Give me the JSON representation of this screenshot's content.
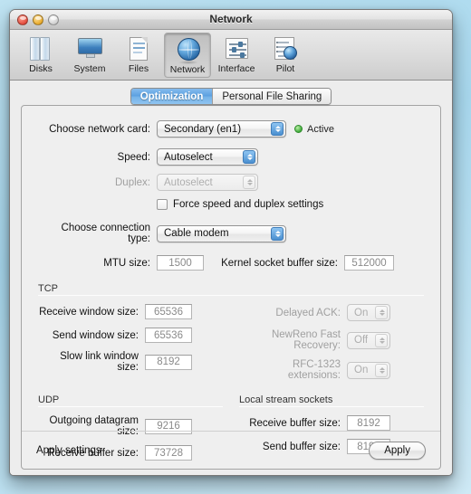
{
  "window": {
    "title": "Network",
    "controls": {
      "close": "close",
      "minimize": "minimize",
      "zoom": "zoom"
    }
  },
  "toolbar": {
    "items": [
      {
        "label": "Disks",
        "icon": "disks-icon",
        "selected": false
      },
      {
        "label": "System",
        "icon": "monitor-icon",
        "selected": false
      },
      {
        "label": "Files",
        "icon": "document-icon",
        "selected": false
      },
      {
        "label": "Network",
        "icon": "globe-icon",
        "selected": true
      },
      {
        "label": "Interface",
        "icon": "sliders-icon",
        "selected": false
      },
      {
        "label": "Pilot",
        "icon": "pilot-icon",
        "selected": false
      }
    ]
  },
  "tabs": [
    {
      "label": "Optimization",
      "active": true
    },
    {
      "label": "Personal File Sharing",
      "active": false
    }
  ],
  "form": {
    "network_card": {
      "label": "Choose network card:",
      "value": "Secondary (en1)",
      "status": "Active",
      "status_color": "#3faa3a"
    },
    "speed": {
      "label": "Speed:",
      "value": "Autoselect",
      "disabled": false
    },
    "duplex": {
      "label": "Duplex:",
      "value": "Autoselect",
      "disabled": true
    },
    "force": {
      "label": "Force speed and duplex settings",
      "checked": false
    },
    "connection_type": {
      "label": "Choose connection type:",
      "value": "Cable modem"
    },
    "mtu": {
      "label": "MTU size:",
      "value": "1500"
    },
    "kernel_buffer": {
      "label": "Kernel socket buffer size:",
      "value": "512000"
    }
  },
  "tcp": {
    "title": "TCP",
    "left": [
      {
        "label": "Receive window size:",
        "value": "65536"
      },
      {
        "label": "Send window size:",
        "value": "65536"
      },
      {
        "label": "Slow link window size:",
        "value": "8192"
      }
    ],
    "right": [
      {
        "label": "Delayed ACK:",
        "value": "On",
        "disabled": true
      },
      {
        "label": "NewReno Fast Recovery:",
        "value": "Off",
        "disabled": true
      },
      {
        "label": "RFC-1323 extensions:",
        "value": "On",
        "disabled": true
      }
    ]
  },
  "udp": {
    "title": "UDP",
    "fields": [
      {
        "label": "Outgoing datagram size:",
        "value": "9216"
      },
      {
        "label": "Receive buffer size:",
        "value": "73728"
      }
    ]
  },
  "local_stream": {
    "title": "Local stream sockets",
    "fields": [
      {
        "label": "Receive buffer size:",
        "value": "8192"
      },
      {
        "label": "Send buffer size:",
        "value": "8192"
      }
    ]
  },
  "footer": {
    "label": "Apply settings",
    "button": "Apply"
  }
}
